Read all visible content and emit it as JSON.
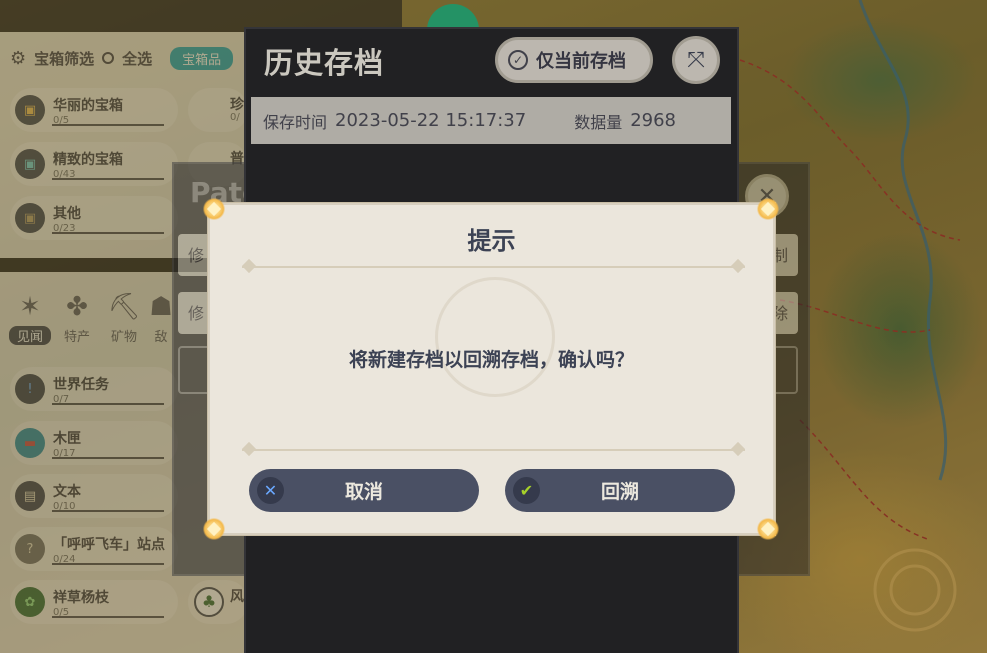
{
  "filter": {
    "title": "宝箱筛选",
    "select_all": "全选",
    "chip": "宝箱品"
  },
  "chests": [
    {
      "name": "华丽的宝箱",
      "count": "0/5"
    },
    {
      "name": "精致的宝箱",
      "count": "0/43"
    },
    {
      "name": "其他",
      "count": "0/23"
    }
  ],
  "chests_right": [
    {
      "name": "珍",
      "count": "0/"
    },
    {
      "name": "普",
      "count": ""
    }
  ],
  "categories": [
    {
      "label": "见闻",
      "icon": "star-icon"
    },
    {
      "label": "特产",
      "icon": "clover-icon"
    },
    {
      "label": "矿物",
      "icon": "pickaxe-icon"
    },
    {
      "label": "敌",
      "icon": "enemy-icon"
    }
  ],
  "items": [
    {
      "name": "世界任务",
      "count": "0/7"
    },
    {
      "name": "木匣",
      "count": "0/17"
    },
    {
      "name": "文本",
      "count": "0/10"
    },
    {
      "name": "「呼呼飞车」站点",
      "count": "0/24"
    },
    {
      "name": "祥草杨枝",
      "count": "0/5"
    }
  ],
  "item_right": {
    "name": "风"
  },
  "patch": {
    "title": "Patc",
    "chip1": "修",
    "chip2": "修",
    "right1": "制",
    "right2": "除"
  },
  "history": {
    "title": "历史存档",
    "current_only": "仅当前存档",
    "save_time_label": "保存时间",
    "save_time": "2023-05-22 15:17:37",
    "data_label": "数据量",
    "data_value": "2968"
  },
  "dialog": {
    "title": "提示",
    "message": "将新建存档以回溯存档，确认吗？",
    "cancel": "取消",
    "confirm": "回溯"
  },
  "colors": {
    "dialog_bg": "#ebe6dc",
    "button_bg": "#4a5064",
    "text_dark": "#3c4254",
    "accent_teal": "#1aa4b8",
    "confirm_check": "#a6d12a"
  }
}
